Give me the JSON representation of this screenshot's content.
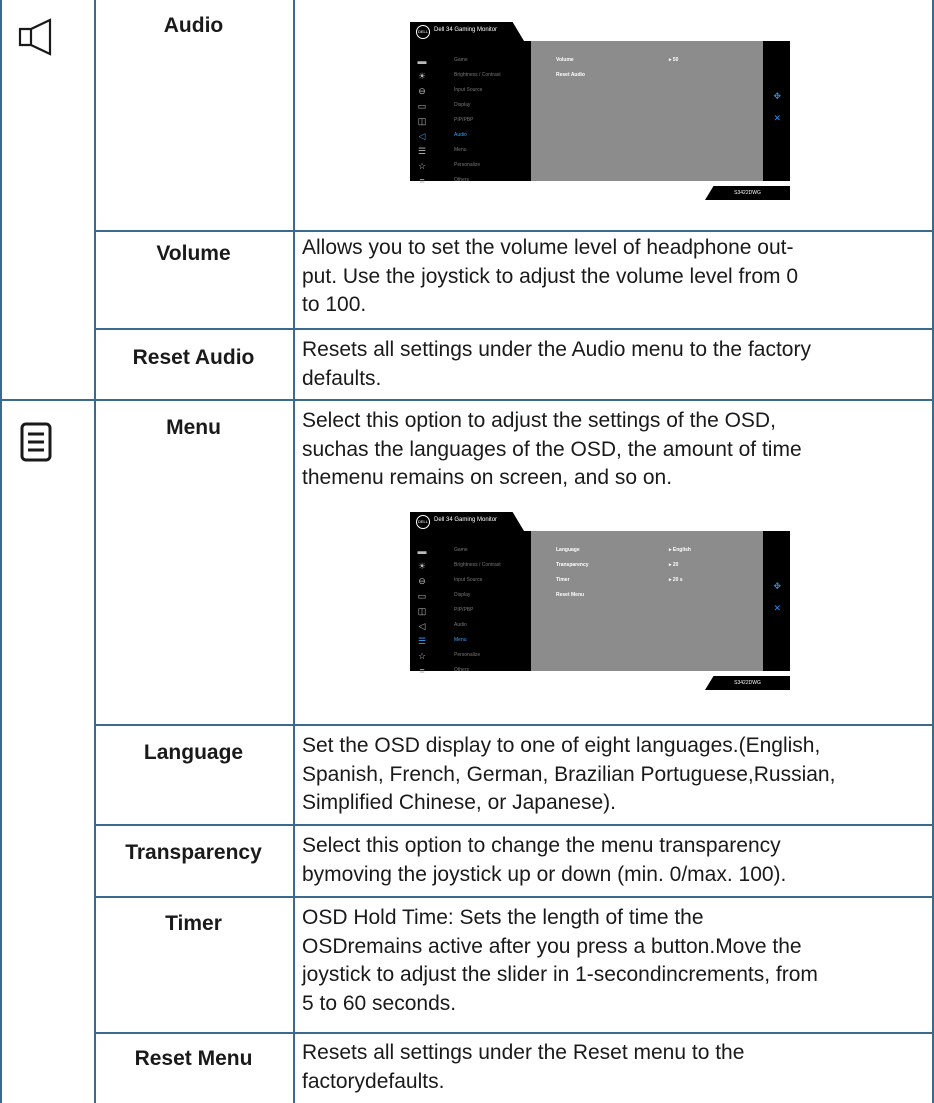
{
  "rows": {
    "audio": {
      "title": "Audio"
    },
    "volume": {
      "title": "Volume",
      "desc": [
        "Allows you to set the volume level of headphone out-",
        "put. Use the joystick to adjust the volume level from 0",
        "to 100."
      ]
    },
    "reset_audio": {
      "title": "Reset Audio",
      "desc": [
        "Resets all settings under the Audio menu to the factory",
        "defaults."
      ]
    },
    "menu": {
      "title": "Menu",
      "desc": [
        "Select this option to adjust the settings of the OSD,",
        "suchas the languages of the OSD, the amount of time",
        "themenu remains on screen, and so on."
      ]
    },
    "language": {
      "title": "Language",
      "desc": [
        "Set the OSD display to one of eight languages.(English,",
        "Spanish, French, German, Brazilian Portuguese,Russian,",
        "Simplified Chinese, or Japanese)."
      ]
    },
    "transparency": {
      "title": "Transparency",
      "desc": [
        "Select this option to change the menu transparency",
        "bymoving the joystick up or down (min. 0/max. 100)."
      ]
    },
    "timer": {
      "title": "Timer",
      "desc": [
        "OSD Hold Time: Sets the length of time the",
        "OSDremains active after you press a button.Move the",
        "joystick to adjust the slider in 1-secondincrements, from",
        "5 to 60 seconds."
      ]
    },
    "reset_menu": {
      "title": "Reset Menu",
      "desc": [
        "Resets all settings under the Reset menu to the",
        "factorydefaults."
      ]
    }
  },
  "osd": {
    "logo": "DELL",
    "title": "Dell 34 Gaming Monitor",
    "model": "S3422DWG",
    "menu_items": [
      "Game",
      "Brightness / Contrast",
      "Input Source",
      "Display",
      "PIP/PBP",
      "Audio",
      "Menu",
      "Personalize",
      "Others"
    ],
    "audio": {
      "options": [
        {
          "label": "Volume",
          "value": "50"
        },
        {
          "label": "Reset Audio",
          "value": ""
        }
      ],
      "active": "Audio"
    },
    "menu": {
      "options": [
        {
          "label": "Language",
          "value": "English"
        },
        {
          "label": "Transparency",
          "value": "20"
        },
        {
          "label": "Timer",
          "value": "20 s"
        },
        {
          "label": "Reset Menu",
          "value": ""
        }
      ],
      "active": "Menu"
    }
  }
}
